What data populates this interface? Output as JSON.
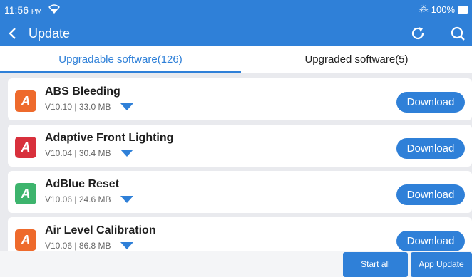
{
  "status": {
    "time": "11:56",
    "ampm": "PM",
    "battery": "100%"
  },
  "header": {
    "title": "Update"
  },
  "tabs": [
    {
      "label": "Upgradable software(126)",
      "active": true
    },
    {
      "label": "Upgraded software(5)",
      "active": false
    }
  ],
  "items": [
    {
      "name": "ABS Bleeding",
      "version": "V10.10 | 33.0 MB",
      "icon_letter": "A",
      "icon_color": "#ee6a2c",
      "button": "Download"
    },
    {
      "name": "Adaptive Front Lighting",
      "version": "V10.04 | 30.4 MB",
      "icon_letter": "A",
      "icon_color": "#d8303c",
      "button": "Download"
    },
    {
      "name": "AdBlue Reset",
      "version": "V10.06 | 24.6 MB",
      "icon_letter": "A",
      "icon_color": "#3db46d",
      "button": "Download"
    },
    {
      "name": "Air Level Calibration",
      "version": "V10.06 | 86.8 MB",
      "icon_letter": "A",
      "icon_color": "#ee6a2c",
      "button": "Download"
    }
  ],
  "bottom": {
    "start_all": "Start all",
    "app_update": "App Update"
  },
  "colors": {
    "primary": "#2f80d8",
    "background": "#e9eaee"
  }
}
